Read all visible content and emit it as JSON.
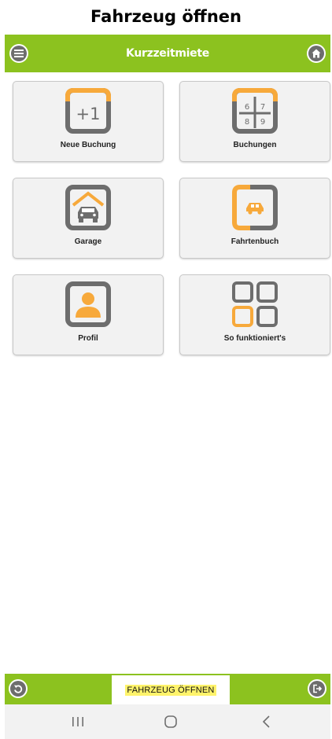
{
  "caption": "Fahrzeug öffnen",
  "header": {
    "title": "Kurzzeitmiete"
  },
  "tiles": [
    {
      "label": "Neue Buchung",
      "icon_text": "+1"
    },
    {
      "label": "Buchungen",
      "icon_digits": [
        "6",
        "7",
        "8",
        "9"
      ]
    },
    {
      "label": "Garage"
    },
    {
      "label": "Fahrtenbuch"
    },
    {
      "label": "Profil"
    },
    {
      "label": "So funktioniert's"
    }
  ],
  "footer": {
    "open_button_label": "FAHRZEUG ÖFFNEN"
  },
  "icons": {
    "menu": "menu-icon",
    "home": "home-icon",
    "back": "back-icon",
    "exit": "exit-icon",
    "new_booking": "plus-one-icon",
    "bookings": "calendar-grid-icon",
    "garage": "garage-car-icon",
    "logbook": "car-book-icon",
    "profile": "user-icon",
    "how_it_works": "four-squares-icon",
    "recents": "recents-icon",
    "home_nav": "home-circle-icon",
    "back_nav": "chevron-left-icon"
  },
  "colors": {
    "accent_green": "#8cc21f",
    "icon_gray": "#6d6d6d",
    "icon_orange": "#f7a93b",
    "tile_bg": "#f2f2f2",
    "highlight": "#fff36b"
  }
}
